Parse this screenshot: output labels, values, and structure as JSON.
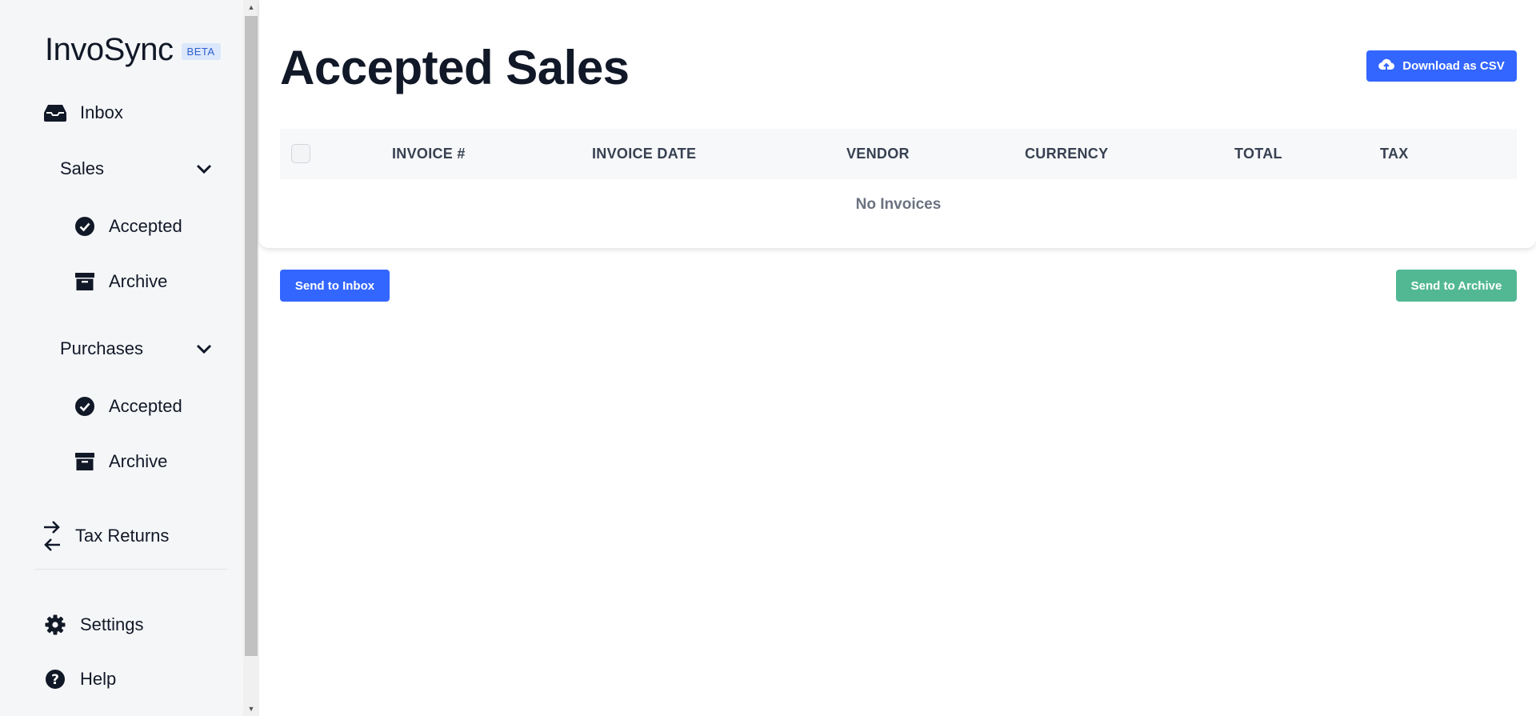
{
  "brand": {
    "name": "InvoSync",
    "badge": "BETA"
  },
  "sidebar": {
    "inbox": {
      "label": "Inbox",
      "icon": "inbox-icon"
    },
    "sales": {
      "label": "Sales",
      "items": [
        {
          "label": "Accepted",
          "icon": "check-circle-icon"
        },
        {
          "label": "Archive",
          "icon": "archive-box-icon"
        }
      ]
    },
    "purchases": {
      "label": "Purchases",
      "items": [
        {
          "label": "Accepted",
          "icon": "check-circle-icon"
        },
        {
          "label": "Archive",
          "icon": "archive-box-icon"
        }
      ]
    },
    "tax_returns": {
      "label": "Tax Returns",
      "icon": "arrows-exchange-icon"
    },
    "settings": {
      "label": "Settings",
      "icon": "gear-icon"
    },
    "help": {
      "label": "Help",
      "icon": "question-circle-icon"
    }
  },
  "main": {
    "title": "Accepted Sales",
    "download_button": "Download as CSV",
    "table": {
      "columns": [
        "INVOICE #",
        "INVOICE DATE",
        "VENDOR",
        "CURRENCY",
        "TOTAL",
        "TAX"
      ],
      "empty_message": "No Invoices"
    },
    "send_to_inbox": "Send to Inbox",
    "send_to_archive": "Send to Archive"
  },
  "colors": {
    "primary": "#3366ff",
    "success": "#52b894",
    "sidebar_bg": "#f5f6f8",
    "badge_bg": "#dbe7fb",
    "badge_text": "#2f5fd0"
  }
}
